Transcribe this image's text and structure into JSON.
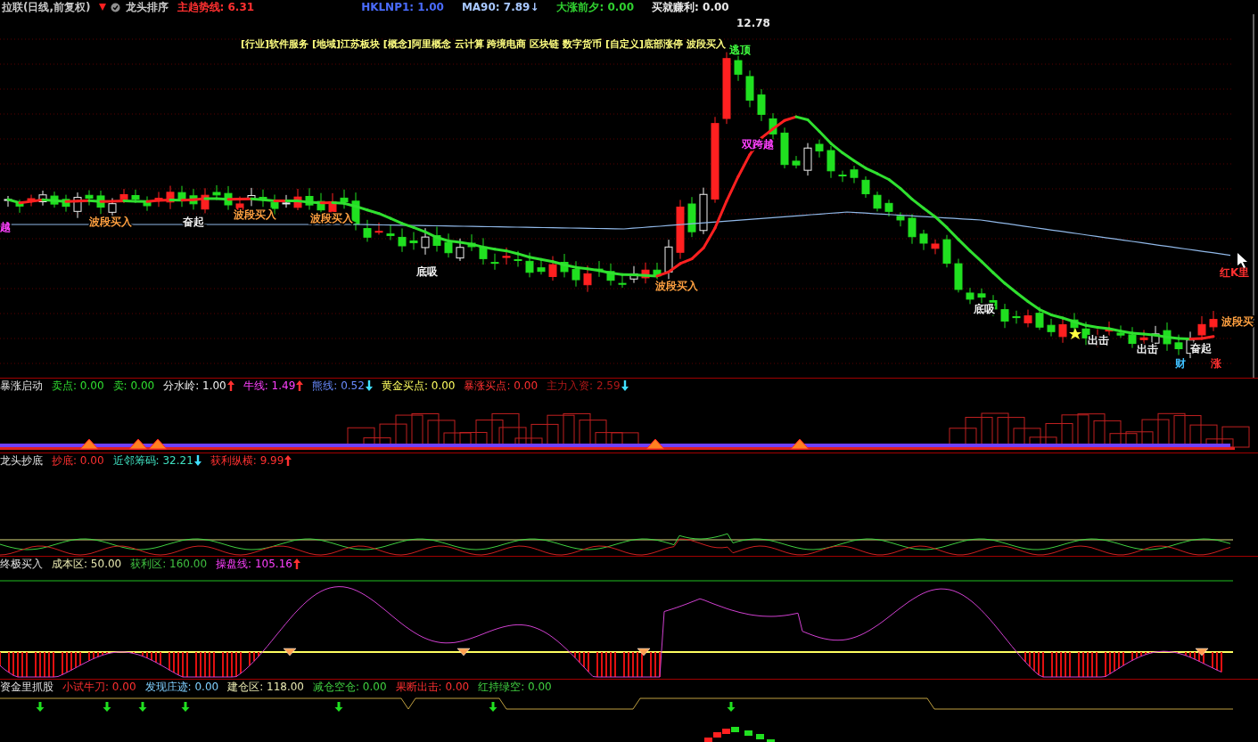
{
  "header": [
    {
      "text": "拉联(日线,前复权)",
      "color": "#c8c8c8"
    },
    {
      "text": "龙头排序",
      "color": "#c8c8c8"
    },
    {
      "text": "主趋势线: 6.31",
      "color": "#ff3030"
    },
    {
      "text": "HKLNP1: 1.00",
      "color": "#4a6cff"
    },
    {
      "text": "MA90: 7.89↓",
      "color": "#a8c8ff"
    },
    {
      "text": "大涨前夕: 0.00",
      "color": "#30d030"
    },
    {
      "text": "买就赚利: 0.00",
      "color": "#e8e8e8"
    }
  ],
  "chart_labels": [
    {
      "text": "[行业]软件服务 [地域]江苏板块 [概念]阿里概念 云计算 跨境电商 区块链 数字货币 [自定义]底部涨停 波段买入",
      "color": "#ffff80"
    },
    {
      "text": "12.78",
      "color": "#e8e8e8"
    },
    {
      "text": "逃顶",
      "color": "#40ff40"
    },
    {
      "text": "双跨越",
      "color": "#ff40ff"
    },
    {
      "text": "越",
      "color": "#ff40ff"
    },
    {
      "text": "波段买入",
      "color": "#ffa040"
    },
    {
      "text": "奋起",
      "color": "#f0f0f0"
    },
    {
      "text": "波段买入",
      "color": "#ffa040"
    },
    {
      "text": "波段买入",
      "color": "#ffa040"
    },
    {
      "text": "底吸",
      "color": "#f0f0f0"
    },
    {
      "text": "波段买入",
      "color": "#ffa040"
    },
    {
      "text": "红K里",
      "color": "#ff3030"
    },
    {
      "text": "底吸",
      "color": "#f0f0f0"
    },
    {
      "text": "波段买",
      "color": "#ffa040"
    },
    {
      "text": "出击",
      "color": "#f0f0f0"
    },
    {
      "text": "出击",
      "color": "#f0f0f0"
    },
    {
      "text": "奋起",
      "color": "#f0f0f0"
    },
    {
      "text": "财",
      "color": "#40c0ff"
    },
    {
      "text": "涨",
      "color": "#ff3030"
    }
  ],
  "panels": [
    {
      "title": "暴涨启动",
      "items": [
        {
          "text": "卖点: 0.00",
          "color": "#30e030"
        },
        {
          "text": "卖: 0.00",
          "color": "#30e030"
        },
        {
          "text": "分水岭: 1.00",
          "color": "#f0f0f0",
          "arrow": {
            "up": true,
            "color": "#ff3030"
          }
        },
        {
          "text": "牛线: 1.49",
          "color": "#ff40ff",
          "arrow": {
            "up": true,
            "color": "#ff3030"
          }
        },
        {
          "text": "熊线: 0.52",
          "color": "#6a8cff",
          "arrow": {
            "up": false,
            "color": "#40e0ff"
          }
        },
        {
          "text": "黄金买点: 0.00",
          "color": "#ffff60"
        },
        {
          "text": "暴涨买点: 0.00",
          "color": "#ff3030"
        },
        {
          "text": "主力入资: 2.59",
          "color": "#b01818",
          "arrow": {
            "up": false,
            "color": "#40e0ff"
          }
        }
      ]
    },
    {
      "title": "龙头抄底",
      "items": [
        {
          "text": "抄底: 0.00",
          "color": "#ff3030"
        },
        {
          "text": "近邻筹码: 32.21",
          "color": "#40e0c0",
          "arrow": {
            "up": false,
            "color": "#40e0ff"
          }
        },
        {
          "text": "获利纵横: 9.99",
          "color": "#ff3030",
          "arrow": {
            "up": true,
            "color": "#ff3030"
          }
        }
      ]
    },
    {
      "title": "终极买入",
      "items": [
        {
          "text": "成本区: 50.00",
          "color": "#e8e8b0"
        },
        {
          "text": "获利区: 160.00",
          "color": "#40c040"
        },
        {
          "text": "操盘线: 105.16",
          "color": "#ff40ff",
          "arrow": {
            "up": true,
            "color": "#ff3030"
          }
        }
      ]
    },
    {
      "title": "资金里抓股",
      "items": [
        {
          "text": "小试牛刀: 0.00",
          "color": "#ff3030"
        },
        {
          "text": "发现庄迹: 0.00",
          "color": "#80d0ff"
        },
        {
          "text": "建仓区: 118.00",
          "color": "#e8e8b0"
        },
        {
          "text": "减仓空仓: 0.00",
          "color": "#40d040"
        },
        {
          "text": "果断出击: 0.00",
          "color": "#ff3030"
        },
        {
          "text": "红持绿空: 0.00",
          "color": "#40d040"
        }
      ]
    }
  ]
}
